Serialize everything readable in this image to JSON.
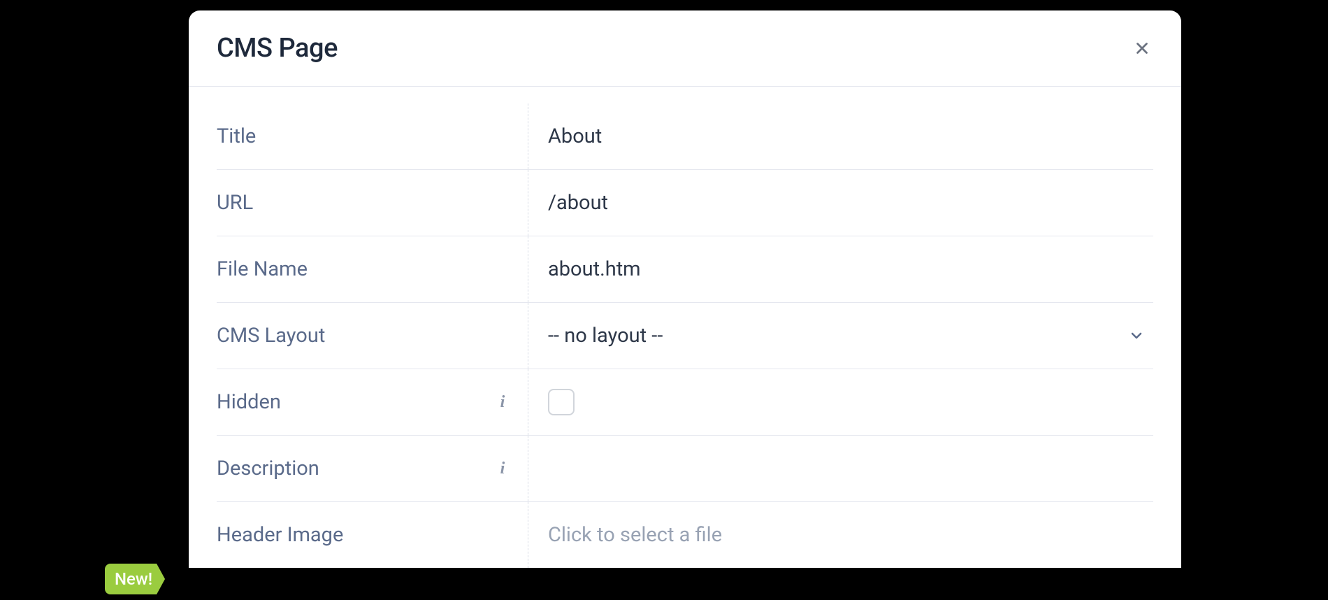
{
  "modal": {
    "title": "CMS Page"
  },
  "fields": {
    "title": {
      "label": "Title",
      "value": "About"
    },
    "url": {
      "label": "URL",
      "value": "/about"
    },
    "fileName": {
      "label": "File Name",
      "value": "about.htm"
    },
    "cmsLayout": {
      "label": "CMS Layout",
      "value": "-- no layout --"
    },
    "hidden": {
      "label": "Hidden",
      "checked": false
    },
    "description": {
      "label": "Description",
      "value": ""
    },
    "headerImage": {
      "label": "Header Image",
      "placeholder": "Click to select a file"
    }
  },
  "badge": {
    "label": "New!"
  }
}
